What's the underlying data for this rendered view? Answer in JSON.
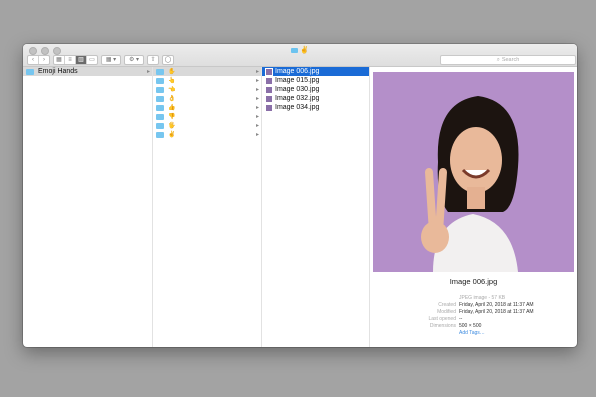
{
  "window": {
    "title_icon": "✌",
    "search_placeholder": "Search"
  },
  "toolbar": {
    "back": "‹",
    "forward": "›",
    "gear": "⚙ ▾",
    "arrange": "▦ ▾",
    "share": "⇧",
    "tag": "◯"
  },
  "col1": {
    "label": "Emoji Hands"
  },
  "col2": {
    "emojis": [
      "✋",
      "👆",
      "👈",
      "👌",
      "👍",
      "👎",
      "🖐",
      "✌"
    ]
  },
  "col3": {
    "files": [
      "Image 006.jpg",
      "Image 015.jpg",
      "Image 030.jpg",
      "Image 032.jpg",
      "Image 034.jpg"
    ]
  },
  "preview": {
    "name": "Image 006.jpg",
    "kind": "JPEG image - 57 KB",
    "created_label": "Created",
    "created": "Friday, April 20, 2018 at 11:37 AM",
    "modified_label": "Modified",
    "modified": "Friday, April 20, 2018 at 11:37 AM",
    "opened_label": "Last opened",
    "opened": "--",
    "dims_label": "Dimensions",
    "dims": "500 × 500",
    "tags": "Add Tags…"
  },
  "colors": {
    "selection": "#1a6bd6",
    "folder": "#77c6ef",
    "background": "#b48fc9"
  }
}
